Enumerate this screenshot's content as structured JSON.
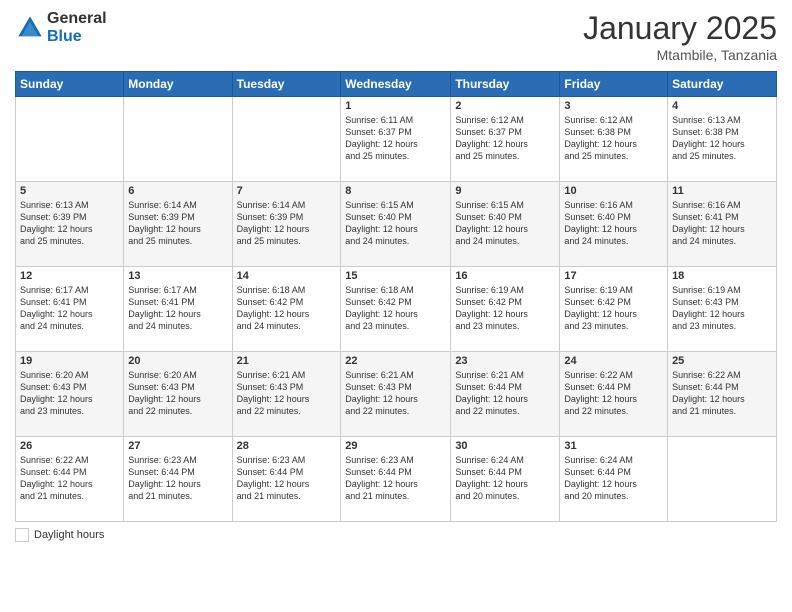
{
  "logo": {
    "general": "General",
    "blue": "Blue"
  },
  "title": "January 2025",
  "location": "Mtambile, Tanzania",
  "days_of_week": [
    "Sunday",
    "Monday",
    "Tuesday",
    "Wednesday",
    "Thursday",
    "Friday",
    "Saturday"
  ],
  "footer_label": "Daylight hours",
  "weeks": [
    [
      {
        "day": "",
        "detail": ""
      },
      {
        "day": "",
        "detail": ""
      },
      {
        "day": "",
        "detail": ""
      },
      {
        "day": "1",
        "detail": "Sunrise: 6:11 AM\nSunset: 6:37 PM\nDaylight: 12 hours\nand 25 minutes."
      },
      {
        "day": "2",
        "detail": "Sunrise: 6:12 AM\nSunset: 6:37 PM\nDaylight: 12 hours\nand 25 minutes."
      },
      {
        "day": "3",
        "detail": "Sunrise: 6:12 AM\nSunset: 6:38 PM\nDaylight: 12 hours\nand 25 minutes."
      },
      {
        "day": "4",
        "detail": "Sunrise: 6:13 AM\nSunset: 6:38 PM\nDaylight: 12 hours\nand 25 minutes."
      }
    ],
    [
      {
        "day": "5",
        "detail": "Sunrise: 6:13 AM\nSunset: 6:39 PM\nDaylight: 12 hours\nand 25 minutes."
      },
      {
        "day": "6",
        "detail": "Sunrise: 6:14 AM\nSunset: 6:39 PM\nDaylight: 12 hours\nand 25 minutes."
      },
      {
        "day": "7",
        "detail": "Sunrise: 6:14 AM\nSunset: 6:39 PM\nDaylight: 12 hours\nand 25 minutes."
      },
      {
        "day": "8",
        "detail": "Sunrise: 6:15 AM\nSunset: 6:40 PM\nDaylight: 12 hours\nand 24 minutes."
      },
      {
        "day": "9",
        "detail": "Sunrise: 6:15 AM\nSunset: 6:40 PM\nDaylight: 12 hours\nand 24 minutes."
      },
      {
        "day": "10",
        "detail": "Sunrise: 6:16 AM\nSunset: 6:40 PM\nDaylight: 12 hours\nand 24 minutes."
      },
      {
        "day": "11",
        "detail": "Sunrise: 6:16 AM\nSunset: 6:41 PM\nDaylight: 12 hours\nand 24 minutes."
      }
    ],
    [
      {
        "day": "12",
        "detail": "Sunrise: 6:17 AM\nSunset: 6:41 PM\nDaylight: 12 hours\nand 24 minutes."
      },
      {
        "day": "13",
        "detail": "Sunrise: 6:17 AM\nSunset: 6:41 PM\nDaylight: 12 hours\nand 24 minutes."
      },
      {
        "day": "14",
        "detail": "Sunrise: 6:18 AM\nSunset: 6:42 PM\nDaylight: 12 hours\nand 24 minutes."
      },
      {
        "day": "15",
        "detail": "Sunrise: 6:18 AM\nSunset: 6:42 PM\nDaylight: 12 hours\nand 23 minutes."
      },
      {
        "day": "16",
        "detail": "Sunrise: 6:19 AM\nSunset: 6:42 PM\nDaylight: 12 hours\nand 23 minutes."
      },
      {
        "day": "17",
        "detail": "Sunrise: 6:19 AM\nSunset: 6:42 PM\nDaylight: 12 hours\nand 23 minutes."
      },
      {
        "day": "18",
        "detail": "Sunrise: 6:19 AM\nSunset: 6:43 PM\nDaylight: 12 hours\nand 23 minutes."
      }
    ],
    [
      {
        "day": "19",
        "detail": "Sunrise: 6:20 AM\nSunset: 6:43 PM\nDaylight: 12 hours\nand 23 minutes."
      },
      {
        "day": "20",
        "detail": "Sunrise: 6:20 AM\nSunset: 6:43 PM\nDaylight: 12 hours\nand 22 minutes."
      },
      {
        "day": "21",
        "detail": "Sunrise: 6:21 AM\nSunset: 6:43 PM\nDaylight: 12 hours\nand 22 minutes."
      },
      {
        "day": "22",
        "detail": "Sunrise: 6:21 AM\nSunset: 6:43 PM\nDaylight: 12 hours\nand 22 minutes."
      },
      {
        "day": "23",
        "detail": "Sunrise: 6:21 AM\nSunset: 6:44 PM\nDaylight: 12 hours\nand 22 minutes."
      },
      {
        "day": "24",
        "detail": "Sunrise: 6:22 AM\nSunset: 6:44 PM\nDaylight: 12 hours\nand 22 minutes."
      },
      {
        "day": "25",
        "detail": "Sunrise: 6:22 AM\nSunset: 6:44 PM\nDaylight: 12 hours\nand 21 minutes."
      }
    ],
    [
      {
        "day": "26",
        "detail": "Sunrise: 6:22 AM\nSunset: 6:44 PM\nDaylight: 12 hours\nand 21 minutes."
      },
      {
        "day": "27",
        "detail": "Sunrise: 6:23 AM\nSunset: 6:44 PM\nDaylight: 12 hours\nand 21 minutes."
      },
      {
        "day": "28",
        "detail": "Sunrise: 6:23 AM\nSunset: 6:44 PM\nDaylight: 12 hours\nand 21 minutes."
      },
      {
        "day": "29",
        "detail": "Sunrise: 6:23 AM\nSunset: 6:44 PM\nDaylight: 12 hours\nand 21 minutes."
      },
      {
        "day": "30",
        "detail": "Sunrise: 6:24 AM\nSunset: 6:44 PM\nDaylight: 12 hours\nand 20 minutes."
      },
      {
        "day": "31",
        "detail": "Sunrise: 6:24 AM\nSunset: 6:44 PM\nDaylight: 12 hours\nand 20 minutes."
      },
      {
        "day": "",
        "detail": ""
      }
    ]
  ]
}
